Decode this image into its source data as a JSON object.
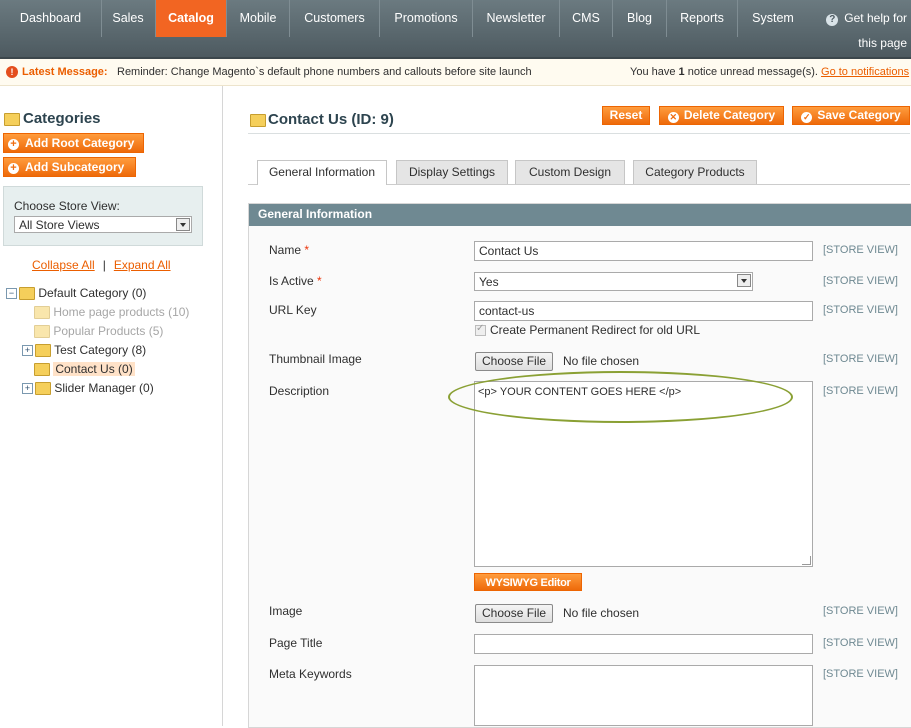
{
  "nav": {
    "items": [
      "Dashboard",
      "Sales",
      "Catalog",
      "Mobile",
      "Customers",
      "Promotions",
      "Newsletter",
      "CMS",
      "Blog",
      "Reports",
      "System"
    ],
    "active": "Catalog",
    "help_line1": "Get help for",
    "help_line2": "this page"
  },
  "message": {
    "latest_label": "Latest Message:",
    "latest_text": "Reminder: Change Magento`s default phone numbers and callouts before site launch",
    "notice_pre": "You have ",
    "notice_count": "1",
    "notice_post": " notice unread message(s). ",
    "notice_link": "Go to notifications"
  },
  "sidebar": {
    "title": "Categories",
    "add_root": "Add Root Category",
    "add_sub": "Add Subcategory",
    "store_view_label": "Choose Store View:",
    "store_view_value": "All Store Views",
    "collapse_all": "Collapse All",
    "expand_all": "Expand All",
    "tree": [
      {
        "label": "Default Category (0)"
      },
      {
        "label": "Home page products (10)"
      },
      {
        "label": "Popular Products (5)"
      },
      {
        "label": "Test Category (8)"
      },
      {
        "label": "Contact Us (0)"
      },
      {
        "label": "Slider Manager (0)"
      }
    ]
  },
  "page": {
    "title": "Contact Us (ID: 9)",
    "reset": "Reset",
    "delete": "Delete Category",
    "save": "Save Category"
  },
  "tabs": [
    "General Information",
    "Display Settings",
    "Custom Design",
    "Category Products"
  ],
  "form": {
    "header": "General Information",
    "store_view_tag": "[STORE VIEW]",
    "name_label": "Name",
    "name_value": "Contact Us",
    "is_active_label": "Is Active",
    "is_active_value": "Yes",
    "url_key_label": "URL Key",
    "url_key_value": "contact-us",
    "redirect_label": "Create Permanent Redirect for old URL",
    "thumbnail_label": "Thumbnail Image",
    "choose_file": "Choose File",
    "no_file": "No file chosen",
    "description_label": "Description",
    "description_value": "<p> YOUR CONTENT GOES HERE </p>",
    "wysiwyg": "WYSIWYG Editor",
    "image_label": "Image",
    "page_title_label": "Page Title",
    "page_title_value": "",
    "meta_keywords_label": "Meta Keywords",
    "required_mark": "*"
  },
  "colors": {
    "accent": "#f26522",
    "nav_bg": "#5b686e",
    "section_header": "#6f8992",
    "highlight_ellipse": "#8aa034"
  }
}
